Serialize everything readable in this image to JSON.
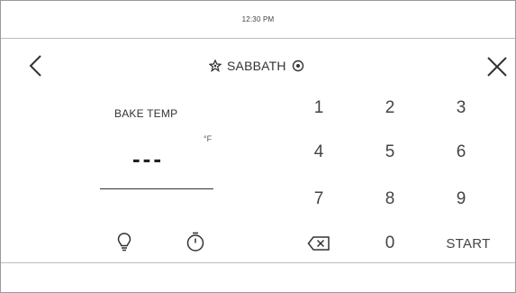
{
  "status": {
    "time": "12:30 PM"
  },
  "header": {
    "sabbath_label": "SABBATH"
  },
  "bake": {
    "label": "BAKE TEMP",
    "unit": "°F",
    "value": "---"
  },
  "keypad": {
    "keys": [
      "1",
      "2",
      "3",
      "4",
      "5",
      "6",
      "7",
      "8",
      "9"
    ],
    "zero": "0",
    "start": "START"
  },
  "icons": [
    "back-chevron",
    "star",
    "info",
    "close",
    "light-bulb",
    "timer",
    "backspace"
  ]
}
